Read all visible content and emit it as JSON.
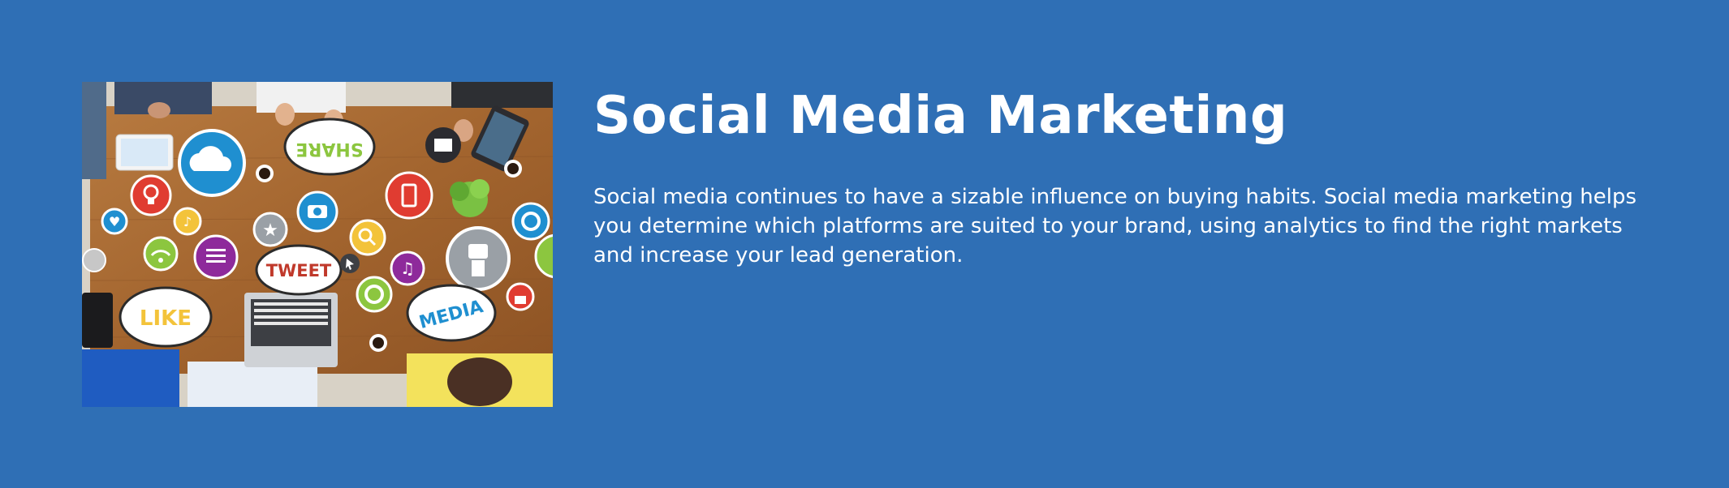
{
  "banner": {
    "title": "Social Media Marketing",
    "description": "Social media continues to have a sizable influence on buying habits. Social media marketing helps you determine which platforms are suited to your brand, using analytics to find the right markets and increase your lead generation.",
    "image": {
      "bubble_share": "SHARE",
      "bubble_tweet": "TWEET",
      "bubble_like": "LIKE",
      "bubble_media": "MEDIA"
    }
  },
  "colors": {
    "background": "#2f6fb5",
    "text": "#ffffff",
    "table_wood": "#a86a35"
  },
  "icons": [
    "cloud-icon",
    "camera-icon",
    "phone-icon",
    "lightbulb-icon",
    "heart-icon",
    "music-icon",
    "star-icon",
    "search-icon",
    "robot-icon",
    "wifi-icon",
    "refresh-icon",
    "lock-icon",
    "folder-icon",
    "list-icon",
    "download-icon"
  ]
}
